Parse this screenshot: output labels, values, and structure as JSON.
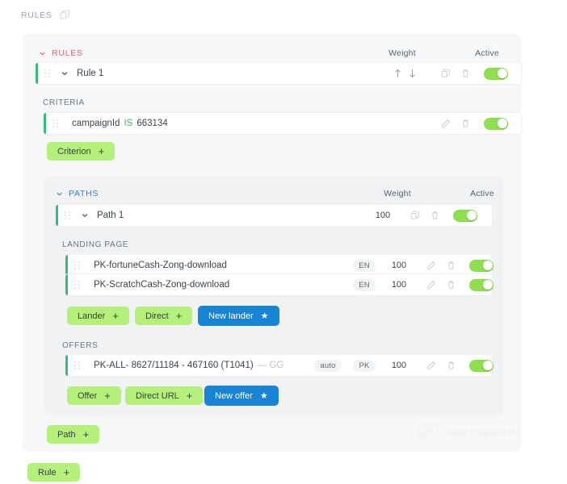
{
  "breadcrumb": {
    "label": "RULES",
    "copy_icon": "copy-icon"
  },
  "columns": {
    "weight": "Weight",
    "active": "Active"
  },
  "rules_section": {
    "title": "RULES",
    "chevron": "chevron-down-icon",
    "rule": {
      "title": "Rule 1",
      "sort_up_icon": "arrow-up-icon",
      "sort_down_icon": "arrow-down-icon",
      "copy_icon": "copy-icon",
      "delete_icon": "trash-icon",
      "active": true
    }
  },
  "criteria": {
    "caption": "CRITERIA",
    "items": [
      {
        "field": "campaignId",
        "operator": "IS",
        "value": "663134",
        "edit_icon": "pencil-icon",
        "delete_icon": "trash-icon",
        "active": true
      }
    ],
    "add_button": {
      "label": "Criterion",
      "plus": "+"
    }
  },
  "paths_section": {
    "title": "PATHS",
    "chevron": "chevron-down-icon",
    "path": {
      "title": "Path 1",
      "weight": "100",
      "copy_icon": "copy-icon",
      "delete_icon": "trash-icon",
      "active": true
    }
  },
  "landing_page": {
    "caption": "LANDING PAGE",
    "items": [
      {
        "name": "PK-fortuneCash-Zong-download",
        "lang": "EN",
        "weight": "100",
        "edit_icon": "pencil-icon",
        "delete_icon": "trash-icon",
        "active": true
      },
      {
        "name": "PK-ScratchCash-Zong-download",
        "lang": "EN",
        "weight": "100",
        "edit_icon": "pencil-icon",
        "delete_icon": "trash-icon",
        "active": true
      }
    ],
    "buttons": {
      "lander": "Lander",
      "direct": "Direct",
      "new_lander": "New lander",
      "plus": "+",
      "star": "★"
    }
  },
  "offers": {
    "caption": "OFFERS",
    "items": [
      {
        "name": "PK-ALL- 8627/11184 - 467160 (T1041)",
        "suffix": "— GG",
        "payout_mode": "auto",
        "country": "PK",
        "weight": "100",
        "edit_icon": "pencil-icon",
        "delete_icon": "trash-icon",
        "active": true
      }
    ],
    "buttons": {
      "offer": "Offer",
      "direct_url": "Direct URL",
      "new_offer": "New offer",
      "plus": "+",
      "star": "★"
    }
  },
  "add_path_button": {
    "label": "Path",
    "plus": "+"
  },
  "add_rule_button": {
    "label": "Rule",
    "plus": "+"
  },
  "watermark": {
    "text": "PARTNERKIN",
    "icon": "speech-bubble-icon"
  },
  "colors": {
    "accent_green": "#3cb878",
    "toggle_green": "#8fe04f",
    "button_green": "#b4f07a",
    "button_blue": "#1784d6",
    "rules_red": "#e8606a",
    "paths_blue": "#3f7fc1",
    "operator_green": "#4cae6a"
  }
}
